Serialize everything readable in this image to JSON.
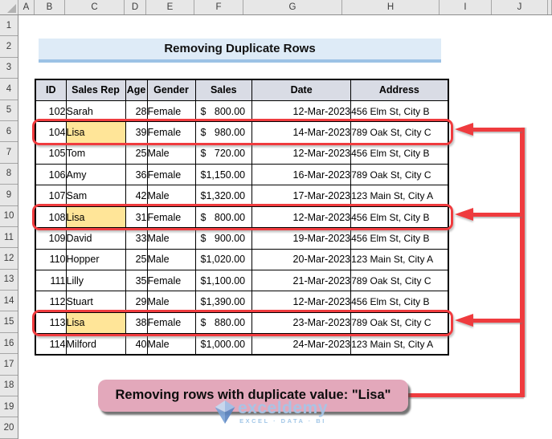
{
  "sheet": {
    "column_letters": [
      "A",
      "B",
      "C",
      "D",
      "E",
      "F",
      "G",
      "H",
      "I",
      "J"
    ],
    "row_numbers": [
      "1",
      "2",
      "3",
      "4",
      "5",
      "6",
      "7",
      "8",
      "9",
      "10",
      "11",
      "12",
      "13",
      "14",
      "15",
      "16",
      "17",
      "18",
      "19",
      "20"
    ]
  },
  "title_banner": {
    "text": "Removing Duplicate Rows"
  },
  "table": {
    "headers": [
      "ID",
      "Sales Rep",
      "Age",
      "Gender",
      "Sales",
      "Date",
      "Address"
    ],
    "currency_symbol": "$",
    "rows": [
      {
        "id": "102",
        "sales_rep": "Sarah",
        "age": "28",
        "gender": "Female",
        "sales": "800.00",
        "date": "12-Mar-2023",
        "address": "456 Elm St, City B",
        "duplicate": false
      },
      {
        "id": "104",
        "sales_rep": "Lisa",
        "age": "39",
        "gender": "Female",
        "sales": "980.00",
        "date": "14-Mar-2023",
        "address": "789 Oak St, City C",
        "duplicate": true
      },
      {
        "id": "105",
        "sales_rep": "Tom",
        "age": "25",
        "gender": "Male",
        "sales": "720.00",
        "date": "12-Mar-2023",
        "address": "456 Elm St, City B",
        "duplicate": false
      },
      {
        "id": "106",
        "sales_rep": "Amy",
        "age": "36",
        "gender": "Female",
        "sales": "1,150.00",
        "date": "16-Mar-2023",
        "address": "789 Oak St, City C",
        "duplicate": false
      },
      {
        "id": "107",
        "sales_rep": "Sam",
        "age": "42",
        "gender": "Male",
        "sales": "1,320.00",
        "date": "17-Mar-2023",
        "address": "123 Main St, City A",
        "duplicate": false
      },
      {
        "id": "108",
        "sales_rep": "Lisa",
        "age": "31",
        "gender": "Female",
        "sales": "800.00",
        "date": "12-Mar-2023",
        "address": "456 Elm St, City B",
        "duplicate": true
      },
      {
        "id": "109",
        "sales_rep": "David",
        "age": "33",
        "gender": "Male",
        "sales": "900.00",
        "date": "19-Mar-2023",
        "address": "456 Elm St, City B",
        "duplicate": false
      },
      {
        "id": "110",
        "sales_rep": "Hopper",
        "age": "25",
        "gender": "Male",
        "sales": "1,020.00",
        "date": "20-Mar-2023",
        "address": "123 Main St, City A",
        "duplicate": false
      },
      {
        "id": "111",
        "sales_rep": "Lilly",
        "age": "35",
        "gender": "Female",
        "sales": "1,100.00",
        "date": "21-Mar-2023",
        "address": "789 Oak St, City C",
        "duplicate": false
      },
      {
        "id": "112",
        "sales_rep": "Stuart",
        "age": "29",
        "gender": "Male",
        "sales": "1,390.00",
        "date": "12-Mar-2023",
        "address": "456 Elm St, City B",
        "duplicate": false
      },
      {
        "id": "113",
        "sales_rep": "Lisa",
        "age": "38",
        "gender": "Female",
        "sales": "880.00",
        "date": "23-Mar-2023",
        "address": "789 Oak St, City C",
        "duplicate": true
      },
      {
        "id": "114",
        "sales_rep": "Milford",
        "age": "40",
        "gender": "Male",
        "sales": "1,000.00",
        "date": "24-Mar-2023",
        "address": "123 Main St, City A",
        "duplicate": false
      }
    ]
  },
  "annotation": {
    "caption": "Removing rows with duplicate value: \"Lisa\"",
    "duplicate_value": "Lisa"
  },
  "watermark": {
    "brand": "exceldemy",
    "tagline": "EXCEL · DATA · BI"
  },
  "colors": {
    "banner_bg": "#DEEBF7",
    "banner_border": "#9CC2E5",
    "table_header_bg": "#D9DCE5",
    "duplicate_highlight": "#FFE598",
    "annotation_red": "#EF3B3E",
    "caption_bg": "#E3A8BB",
    "watermark_blue": "#A5C6E8"
  }
}
